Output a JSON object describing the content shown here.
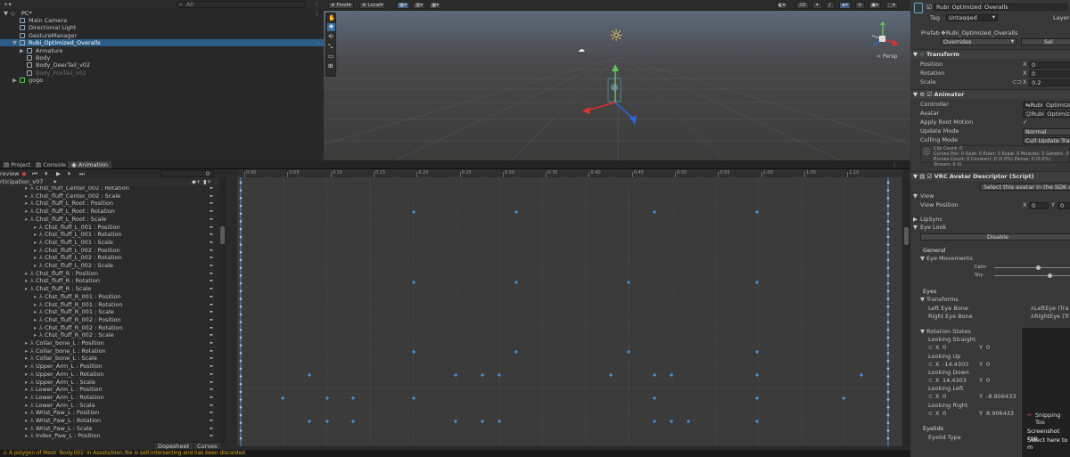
{
  "hierarchy": {
    "search_placeholder": "All",
    "scene_name": "PC*",
    "items": [
      {
        "label": "Main Camera",
        "depth": 1,
        "icon": "gameobject-icon"
      },
      {
        "label": "Directional Light",
        "depth": 1,
        "icon": "gameobject-icon"
      },
      {
        "label": "GestureManager",
        "depth": 1,
        "icon": "gameobject-icon"
      },
      {
        "label": "Rubi_Optimized_Overalls",
        "depth": 1,
        "icon": "prefab-icon",
        "selected": true
      },
      {
        "label": "Armature",
        "depth": 2,
        "icon": "gameobject-icon"
      },
      {
        "label": "Body",
        "depth": 2,
        "icon": "gameobject-icon"
      },
      {
        "label": "Body_DeerTail_v02",
        "depth": 2,
        "icon": "gameobject-icon"
      },
      {
        "label": "Body_FoxTail_v02",
        "depth": 2,
        "icon": "gameobject-icon",
        "dim": true
      },
      {
        "label": "gogo",
        "depth": 1,
        "icon": "prefab-icon"
      }
    ]
  },
  "scene_toolbar": {
    "pivot": "Pivot",
    "local": "Local",
    "mode_2d": "2D",
    "layers": "Layers",
    "persp": "< Persp"
  },
  "tabs": {
    "project": "Project",
    "console": "Console",
    "animation": "Animation"
  },
  "animation": {
    "preview": "review",
    "frame": "0",
    "clip": "rticipation_v07",
    "ruler": [
      "0:00",
      "0:05",
      "0:10",
      "0:15",
      "0:20",
      "0:25",
      "0:30",
      "0:35",
      "0:40",
      "0:45",
      "0:50",
      "0:55",
      "1:00",
      "1:05",
      "1:10"
    ],
    "dopesheet": "Dopesheet",
    "curves": "Curves",
    "properties": [
      "Chst_fluff_Center_002 : Rotation",
      "Chst_fluff_Center_002 : Scale",
      "Chst_fluff_L_Root : Position",
      "Chst_fluff_L_Root : Rotation",
      "Chst_fluff_L_Root : Scale",
      "Chst_fluff_L_001 : Position",
      "Chst_fluff_L_001 : Rotation",
      "Chst_fluff_L_001 : Scale",
      "Chst_fluff_L_002 : Position",
      "Chst_fluff_L_002 : Rotation",
      "Chst_fluff_L_002 : Scale",
      "Chst_fluff_R : Position",
      "Chst_fluff_R : Rotation",
      "Chst_fluff_R : Scale",
      "Chst_fluff_R_001 : Position",
      "Chst_fluff_R_001 : Rotation",
      "Chst_fluff_R_001 : Scale",
      "Chst_fluff_R_002 : Position",
      "Chst_fluff_R_002 : Rotation",
      "Chst_fluff_R_002 : Scale",
      "Collar_bone_L : Position",
      "Collar_bone_L : Rotation",
      "Collar_bone_L : Scale",
      "Upper_Arm_L : Position",
      "Upper_Arm_L : Rotation",
      "Upper_Arm_L : Scale",
      "Lower_Arm_L : Position",
      "Lower_Arm_L : Rotation",
      "Lower_Arm_L : Scale",
      "Wrist_Paw_L : Position",
      "Wrist_Paw_L : Rotation",
      "Wrist_Paw_L : Scale",
      "Index_Paw_L : Position"
    ]
  },
  "status": "A polygon of Mesh 'Body.001' in Assets/blen.fbx is self-intersecting and has been discarded.",
  "inspector": {
    "object_name": "Rubi_Optimized_Overalls",
    "tag_label": "Tag",
    "tag_value": "Untagged",
    "layer_label": "Layer",
    "prefab_label": "Prefab",
    "prefab_value": "Rubi_Optimized_Overalls",
    "overrides": "Overrides",
    "select": "Sel",
    "transform": {
      "title": "Transform",
      "position": "Position",
      "rotation": "Rotation",
      "scale": "Scale",
      "px": "0",
      "rx": "0",
      "sx": "0.2"
    },
    "animator": {
      "title": "Animator",
      "controller": "Controller",
      "controller_value": "Rubi_Optimized",
      "avatar": "Avatar",
      "avatar_value": "Rubi_Optimized_",
      "apply_root_motion": "Apply Root Motion",
      "update_mode": "Update Mode",
      "update_value": "Normal",
      "culling_mode": "Culling Mode",
      "culling_value": "Cull Update Trans",
      "info1": "Clip Count: 0",
      "info2": "Curves Pos: 0 Quat: 0 Euler: 0 Scale: 0 Muscles: 0 Generic: 0 P",
      "info3": "Curves Count: 0 Constant: 0 (0.0%) Dense: 0 (0.0%) Stream: 0 (0"
    },
    "vrc": {
      "title": "VRC Avatar Descriptor (Script)",
      "select_btn": "Select this avatar in the SDK c",
      "view": "View",
      "view_position": "View Position",
      "vx": "0",
      "vy": "0",
      "lipsync": "LipSync",
      "eyelook": "Eye Look",
      "disable": "Disable",
      "general": "General",
      "eye_movements": "Eye Movements",
      "calm": "Calm",
      "shy": "Shy",
      "eyes": "Eyes",
      "transforms": "Transforms",
      "left_eye": "Left Eye Bone",
      "left_eye_value": "LeftEye (Tra",
      "right_eye": "Right Eye Bone",
      "right_eye_value": "RightEye (Tra",
      "rotation_states": "Rotation States",
      "looking_straight": "Looking Straight",
      "looking_up": "Looking Up",
      "looking_down": "Looking Down",
      "looking_left": "Looking Left",
      "looking_right": "Looking Right",
      "ls_x": "0",
      "ls_y": "0",
      "lu_x": "-14.4303",
      "lu_y": "0",
      "ld_x": "14.4303",
      "ld_y": "0",
      "ll_x": "0",
      "ll_y": "-8.906433",
      "lr_x": "0",
      "lr_y": "8.906433",
      "eyelids": "Eyelids",
      "eyelid_type": "Eyelid Type"
    }
  },
  "snipping": {
    "title": "Snipping Too",
    "line1": "Screenshot cop",
    "line2": "Select here to m"
  },
  "colors": {
    "accent": "#3f8ed8",
    "selection": "#2c5d87",
    "warning": "#d9a520"
  }
}
